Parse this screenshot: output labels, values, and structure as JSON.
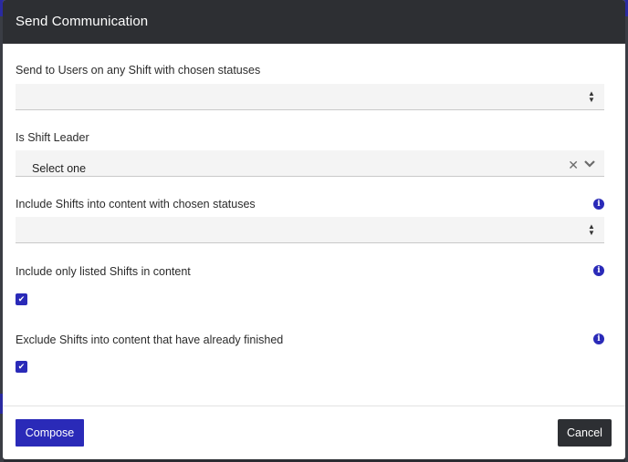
{
  "modal": {
    "title": "Send Communication"
  },
  "fields": {
    "users_statuses": {
      "label": "Send to Users on any Shift with chosen statuses",
      "value": ""
    },
    "shift_leader": {
      "label": "Is Shift Leader",
      "value": "Select one"
    },
    "content_statuses": {
      "label": "Include Shifts into content with chosen statuses",
      "value": ""
    },
    "only_listed": {
      "label": "Include only listed Shifts in content",
      "checked": true
    },
    "exclude_finished": {
      "label": "Exclude Shifts into content that have already finished",
      "checked": true
    }
  },
  "footer": {
    "compose_label": "Compose",
    "cancel_label": "Cancel"
  },
  "colors": {
    "accent": "#2a2ab8",
    "header_bg": "#2d2f33"
  },
  "icons": {
    "info": "info-icon",
    "sort": "sort-icon",
    "clear": "clear-icon",
    "chevron": "chevron-down-icon",
    "check": "check-icon"
  }
}
